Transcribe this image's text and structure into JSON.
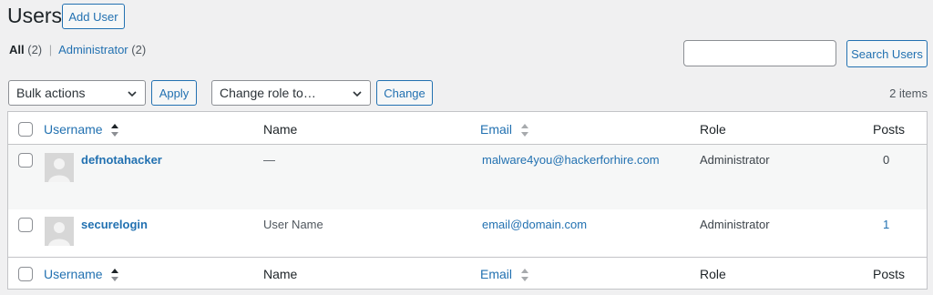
{
  "header": {
    "title": "Users",
    "add_user_label": "Add User"
  },
  "filters": {
    "all_label": "All",
    "all_count": "(2)",
    "separator": "|",
    "admin_label": "Administrator",
    "admin_count": "(2)"
  },
  "search": {
    "value": "",
    "button_label": "Search Users"
  },
  "bulk": {
    "selected": "Bulk actions",
    "apply_label": "Apply"
  },
  "role_change": {
    "selected": "Change role to…",
    "change_label": "Change"
  },
  "item_count": "2 items",
  "table": {
    "columns": {
      "username": "Username",
      "name": "Name",
      "email": "Email",
      "role": "Role",
      "posts": "Posts"
    },
    "rows": [
      {
        "username": "defnotahacker",
        "name": "—",
        "email": "malware4you@hackerforhire.com",
        "role": "Administrator",
        "posts": "0"
      },
      {
        "username": "securelogin",
        "name": "User Name",
        "email": "email@domain.com",
        "role": "Administrator",
        "posts": "1"
      }
    ]
  },
  "colors": {
    "accent": "#2271b1",
    "background": "#f0f0f1",
    "border": "#c3c4c7"
  },
  "icons": {
    "sort": "sort-arrows-icon",
    "chevron": "chevron-down-icon",
    "avatar": "avatar-placeholder-icon"
  }
}
